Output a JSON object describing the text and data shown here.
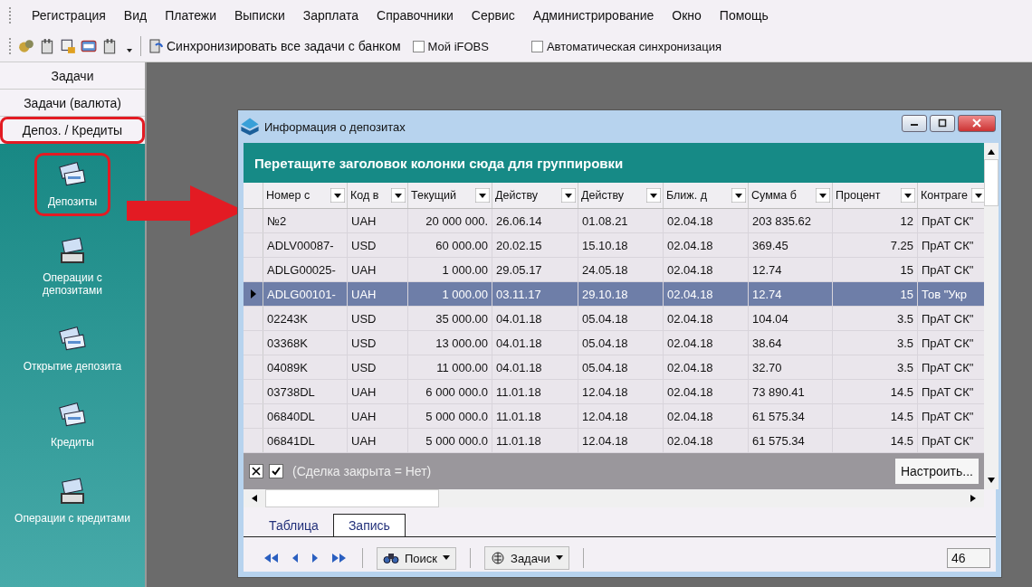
{
  "menu": [
    "Регистрация",
    "Вид",
    "Платежи",
    "Выписки",
    "Зарплата",
    "Справочники",
    "Сервис",
    "Администрирование",
    "Окно",
    "Помощь"
  ],
  "toolbar": {
    "sync_label": "Синхронизировать все задачи с банком",
    "checks": [
      {
        "label": "Мой iFOBS",
        "checked": false
      },
      {
        "label": "Автоматическая синхронизация",
        "checked": false
      }
    ]
  },
  "sidebar": {
    "groups": [
      {
        "label": "Задачи",
        "highlighted": false
      },
      {
        "label": "Задачи (валюта)",
        "highlighted": false
      },
      {
        "label": "Депоз. / Кредиты",
        "highlighted": true
      }
    ],
    "items": [
      {
        "label": "Депозиты",
        "kind": "cards",
        "highlighted": true
      },
      {
        "label": "Операции с депозитами",
        "kind": "terminal",
        "highlighted": false
      },
      {
        "label": "Открытие депозита",
        "kind": "cards",
        "highlighted": false
      },
      {
        "label": "Кредиты",
        "kind": "cards",
        "highlighted": false
      },
      {
        "label": "Операции с кредитами",
        "kind": "terminal",
        "highlighted": false
      }
    ]
  },
  "annotation_arrow": true,
  "window": {
    "title": "Информация о депозитах",
    "group_panel": "Перетащите заголовок колонки сюда для группировки",
    "columns": [
      "Номер с",
      "Код в",
      "Текущий",
      "Действу",
      "Действу",
      "Ближ. д",
      "Сумма б",
      "Процент",
      "Контраге"
    ],
    "rows": [
      {
        "selected": false,
        "cells": [
          "№2",
          "UAH",
          "20 000 000.",
          "26.06.14",
          "01.08.21",
          "02.04.18",
          "203 835.62",
          "12",
          "ПрАТ СК\""
        ]
      },
      {
        "selected": false,
        "cells": [
          "ADLV00087-",
          "USD",
          "60 000.00",
          "20.02.15",
          "15.10.18",
          "02.04.18",
          "369.45",
          "7.25",
          "ПрАТ СК\""
        ]
      },
      {
        "selected": false,
        "cells": [
          "ADLG00025-",
          "UAH",
          "1 000.00",
          "29.05.17",
          "24.05.18",
          "02.04.18",
          "12.74",
          "15",
          "ПрАТ СК\""
        ]
      },
      {
        "selected": true,
        "cells": [
          "ADLG00101-",
          "UAH",
          "1 000.00",
          "03.11.17",
          "29.10.18",
          "02.04.18",
          "12.74",
          "15",
          "Тов \"Укр"
        ]
      },
      {
        "selected": false,
        "cells": [
          "02243K",
          "USD",
          "35 000.00",
          "04.01.18",
          "05.04.18",
          "02.04.18",
          "104.04",
          "3.5",
          "ПрАТ СК\""
        ]
      },
      {
        "selected": false,
        "cells": [
          "03368K",
          "USD",
          "13 000.00",
          "04.01.18",
          "05.04.18",
          "02.04.18",
          "38.64",
          "3.5",
          "ПрАТ СК\""
        ]
      },
      {
        "selected": false,
        "cells": [
          "04089K",
          "USD",
          "11 000.00",
          "04.01.18",
          "05.04.18",
          "02.04.18",
          "32.70",
          "3.5",
          "ПрАТ СК\""
        ]
      },
      {
        "selected": false,
        "cells": [
          "03738DL",
          "UAH",
          "6 000 000.0",
          "11.01.18",
          "12.04.18",
          "02.04.18",
          "73 890.41",
          "14.5",
          "ПрАТ СК\""
        ]
      },
      {
        "selected": false,
        "cells": [
          "06840DL",
          "UAH",
          "5 000 000.0",
          "11.01.18",
          "12.04.18",
          "02.04.18",
          "61 575.34",
          "14.5",
          "ПрАТ СК\""
        ]
      },
      {
        "selected": false,
        "cells": [
          "06841DL",
          "UAH",
          "5 000 000.0",
          "11.01.18",
          "12.04.18",
          "02.04.18",
          "61 575.34",
          "14.5",
          "ПрАТ СК\""
        ]
      }
    ],
    "filter": {
      "enabled": true,
      "text": "(Сделка закрыта = Нет)",
      "button": "Настроить..."
    },
    "tabs": [
      {
        "label": "Таблица",
        "selected": false
      },
      {
        "label": "Запись",
        "selected": true
      }
    ],
    "nav": {
      "search": "Поиск",
      "tasks": "Задачи",
      "count": "46"
    }
  }
}
